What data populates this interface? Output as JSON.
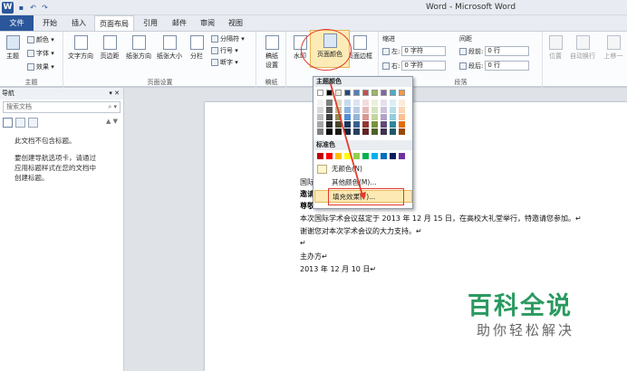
{
  "window": {
    "title": "Word - Microsoft Word"
  },
  "qat": {
    "logo": "W",
    "save": "save-icon",
    "undo": "↶",
    "redo": "↷"
  },
  "tabs": [
    "文件",
    "开始",
    "插入",
    "页面布局",
    "引用",
    "邮件",
    "审阅",
    "视图"
  ],
  "ribbon": {
    "theme": {
      "big": "主题",
      "colors": "颜色 ▾",
      "fonts": "字体 ▾",
      "effects": "效果 ▾",
      "group": "主题"
    },
    "page_setup": {
      "direction": "文字方向",
      "margins": "页边距",
      "orientation": "纸张方向",
      "size": "纸张大小",
      "columns": "分栏",
      "breaks": "分隔符 ▾",
      "line_numbers": "行号 ▾",
      "hyphenation": "断字 ▾",
      "group": "页面设置"
    },
    "draft": {
      "label_a": "稿纸",
      "label_b": "设置",
      "group": "稿纸"
    },
    "background": {
      "watermark": "水印",
      "page_color": "页面颜色",
      "borders": "页面边框"
    },
    "paragraph": {
      "indent": "缩进",
      "spacing": "间距",
      "left_label": "左:",
      "left_value": "0 字符",
      "right_label": "右:",
      "right_value": "0 字符",
      "before_label": "段前:",
      "before_value": "0 行",
      "after_label": "段后:",
      "after_value": "0 行",
      "group": "段落"
    },
    "arrange": {
      "position": "位置",
      "wrap": "自动换行",
      "forward": "上移一"
    }
  },
  "nav": {
    "title": "导航",
    "search_placeholder": "搜索文档",
    "no_headings": "此文档不包含标题。",
    "hint": "要创建导航选项卡，请通过应用标题样式在您的文档中创建标题。"
  },
  "color_menu": {
    "theme_title": "主题颜色",
    "standard_title": "标准色",
    "no_color": "无颜色(N)",
    "more_colors": "其他颜色(M)...",
    "fill_effects": "填充效果(F)...",
    "theme_top": [
      "#ffffff",
      "#000000",
      "#eeece1",
      "#1f497d",
      "#4f81bd",
      "#c0504d",
      "#9bbb59",
      "#8064a2",
      "#4bacc6",
      "#f79646"
    ],
    "theme_shades": [
      [
        "#f2f2f2",
        "#7f7f7f",
        "#ddd9c3",
        "#c6d9f0",
        "#dbe5f1",
        "#f2dcdb",
        "#ebf1dd",
        "#e5e0ec",
        "#dbeef3",
        "#fdeada"
      ],
      [
        "#d8d8d8",
        "#595959",
        "#c4bd97",
        "#8db3e2",
        "#b8cce4",
        "#e5b9b7",
        "#d7e3bc",
        "#ccc1d9",
        "#b7dde8",
        "#fbd5b5"
      ],
      [
        "#bfbfbf",
        "#3f3f3f",
        "#938953",
        "#548dd4",
        "#95b3d7",
        "#d99694",
        "#c3d69b",
        "#b2a2c7",
        "#92cddc",
        "#fac08f"
      ],
      [
        "#a5a5a5",
        "#262626",
        "#494429",
        "#17365d",
        "#366092",
        "#953734",
        "#76923c",
        "#5f497a",
        "#31859b",
        "#e36c09"
      ],
      [
        "#7f7f7f",
        "#0c0c0c",
        "#1d1b10",
        "#0f243e",
        "#244061",
        "#632423",
        "#4f6128",
        "#3f3151",
        "#205867",
        "#974806"
      ]
    ],
    "standard": [
      "#c00000",
      "#ff0000",
      "#ffc000",
      "#ffff00",
      "#92d050",
      "#00b050",
      "#00b0f0",
      "#0070c0",
      "#002060",
      "#7030a0"
    ]
  },
  "doc": {
    "line1": "国际",
    "line2": "邀请",
    "line3": "尊敬",
    "line4": "本次国际学术会议兹定于 2013 年 12 月 15 日，在高校大礼堂举行，特邀请您参加。↵",
    "line5": "谢谢您对本次学术会议的大力支持。↵",
    "line6": "↵",
    "line7": "主办方↵",
    "line8": "2013 年 12 月 10 日↵"
  },
  "watermark": {
    "title": "百科全说",
    "subtitle": "助你轻松解决"
  },
  "accent": {
    "file_tab": "#2b579a",
    "highlight": "#fcebb7",
    "annotation": "#e23a2d",
    "watermark": "#2a9a60"
  }
}
